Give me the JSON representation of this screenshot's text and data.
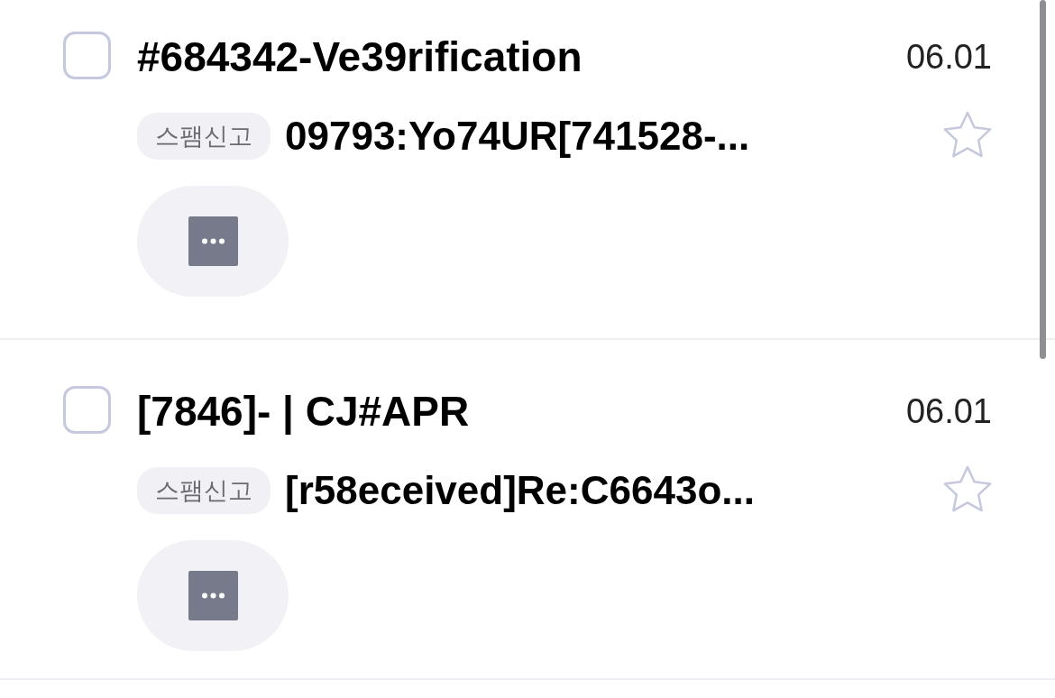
{
  "messages": [
    {
      "checked": false,
      "title": "#684342-Ve39rification",
      "date": "06.01",
      "tag": "스팸신고",
      "preview": "09793:Yo74UR[741528-...",
      "starred": false
    },
    {
      "checked": false,
      "title": "[7846]- | CJ#APR",
      "date": "06.01",
      "tag": "스팸신고",
      "preview": "[r58eceived]Re:C6643o...",
      "starred": false
    }
  ]
}
